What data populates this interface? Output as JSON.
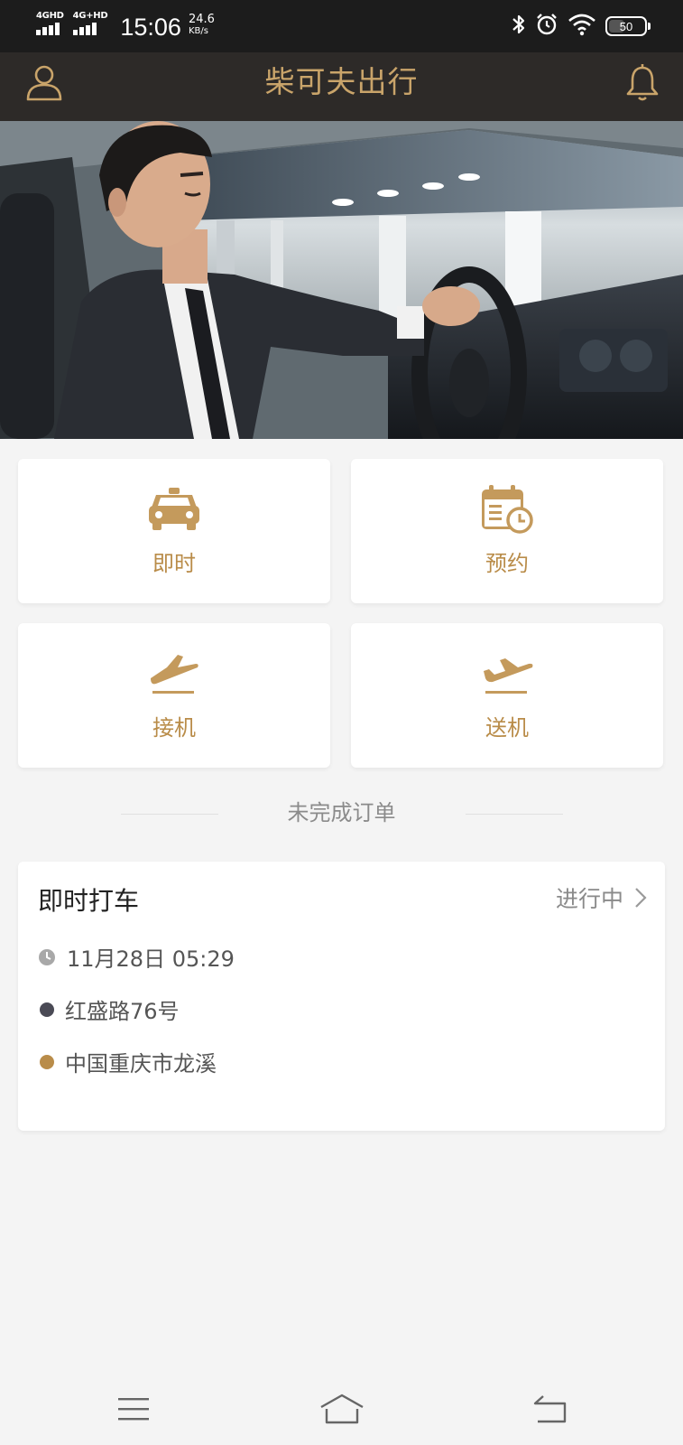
{
  "status_bar": {
    "network1": "4GHD",
    "network2": "4G+HD",
    "time": "15:06",
    "speed_value": "24.6",
    "speed_unit": "KB/s",
    "battery": "50",
    "battery_level": 0.5,
    "icons": [
      "bluetooth-icon",
      "alarm-icon",
      "wifi-icon",
      "battery-icon"
    ]
  },
  "header": {
    "title": "柴可夫出行",
    "left_icon": "user-icon",
    "right_icon": "bell-icon"
  },
  "banner": {
    "image": "driver-in-car-photo"
  },
  "services": [
    {
      "label": "即时",
      "icon": "taxi-icon"
    },
    {
      "label": "预约",
      "icon": "calendar-clock-icon"
    },
    {
      "label": "接机",
      "icon": "plane-landing-icon"
    },
    {
      "label": "送机",
      "icon": "plane-takeoff-icon"
    }
  ],
  "orders_section": {
    "title": "未完成订单"
  },
  "order": {
    "type": "即时打车",
    "status": "进行中",
    "time": "11月28日 05:29",
    "from": "红盛路76号",
    "to": "中国重庆市龙溪"
  },
  "colors": {
    "accent": "#b98c49",
    "header_bg": "#2d2a28",
    "status_bar_bg": "#1c1c1c",
    "page_bg": "#f4f4f4",
    "from_dot": "#4a4a55",
    "to_dot": "#b98c49"
  },
  "nav": [
    "menu-icon",
    "home-icon",
    "back-icon"
  ]
}
